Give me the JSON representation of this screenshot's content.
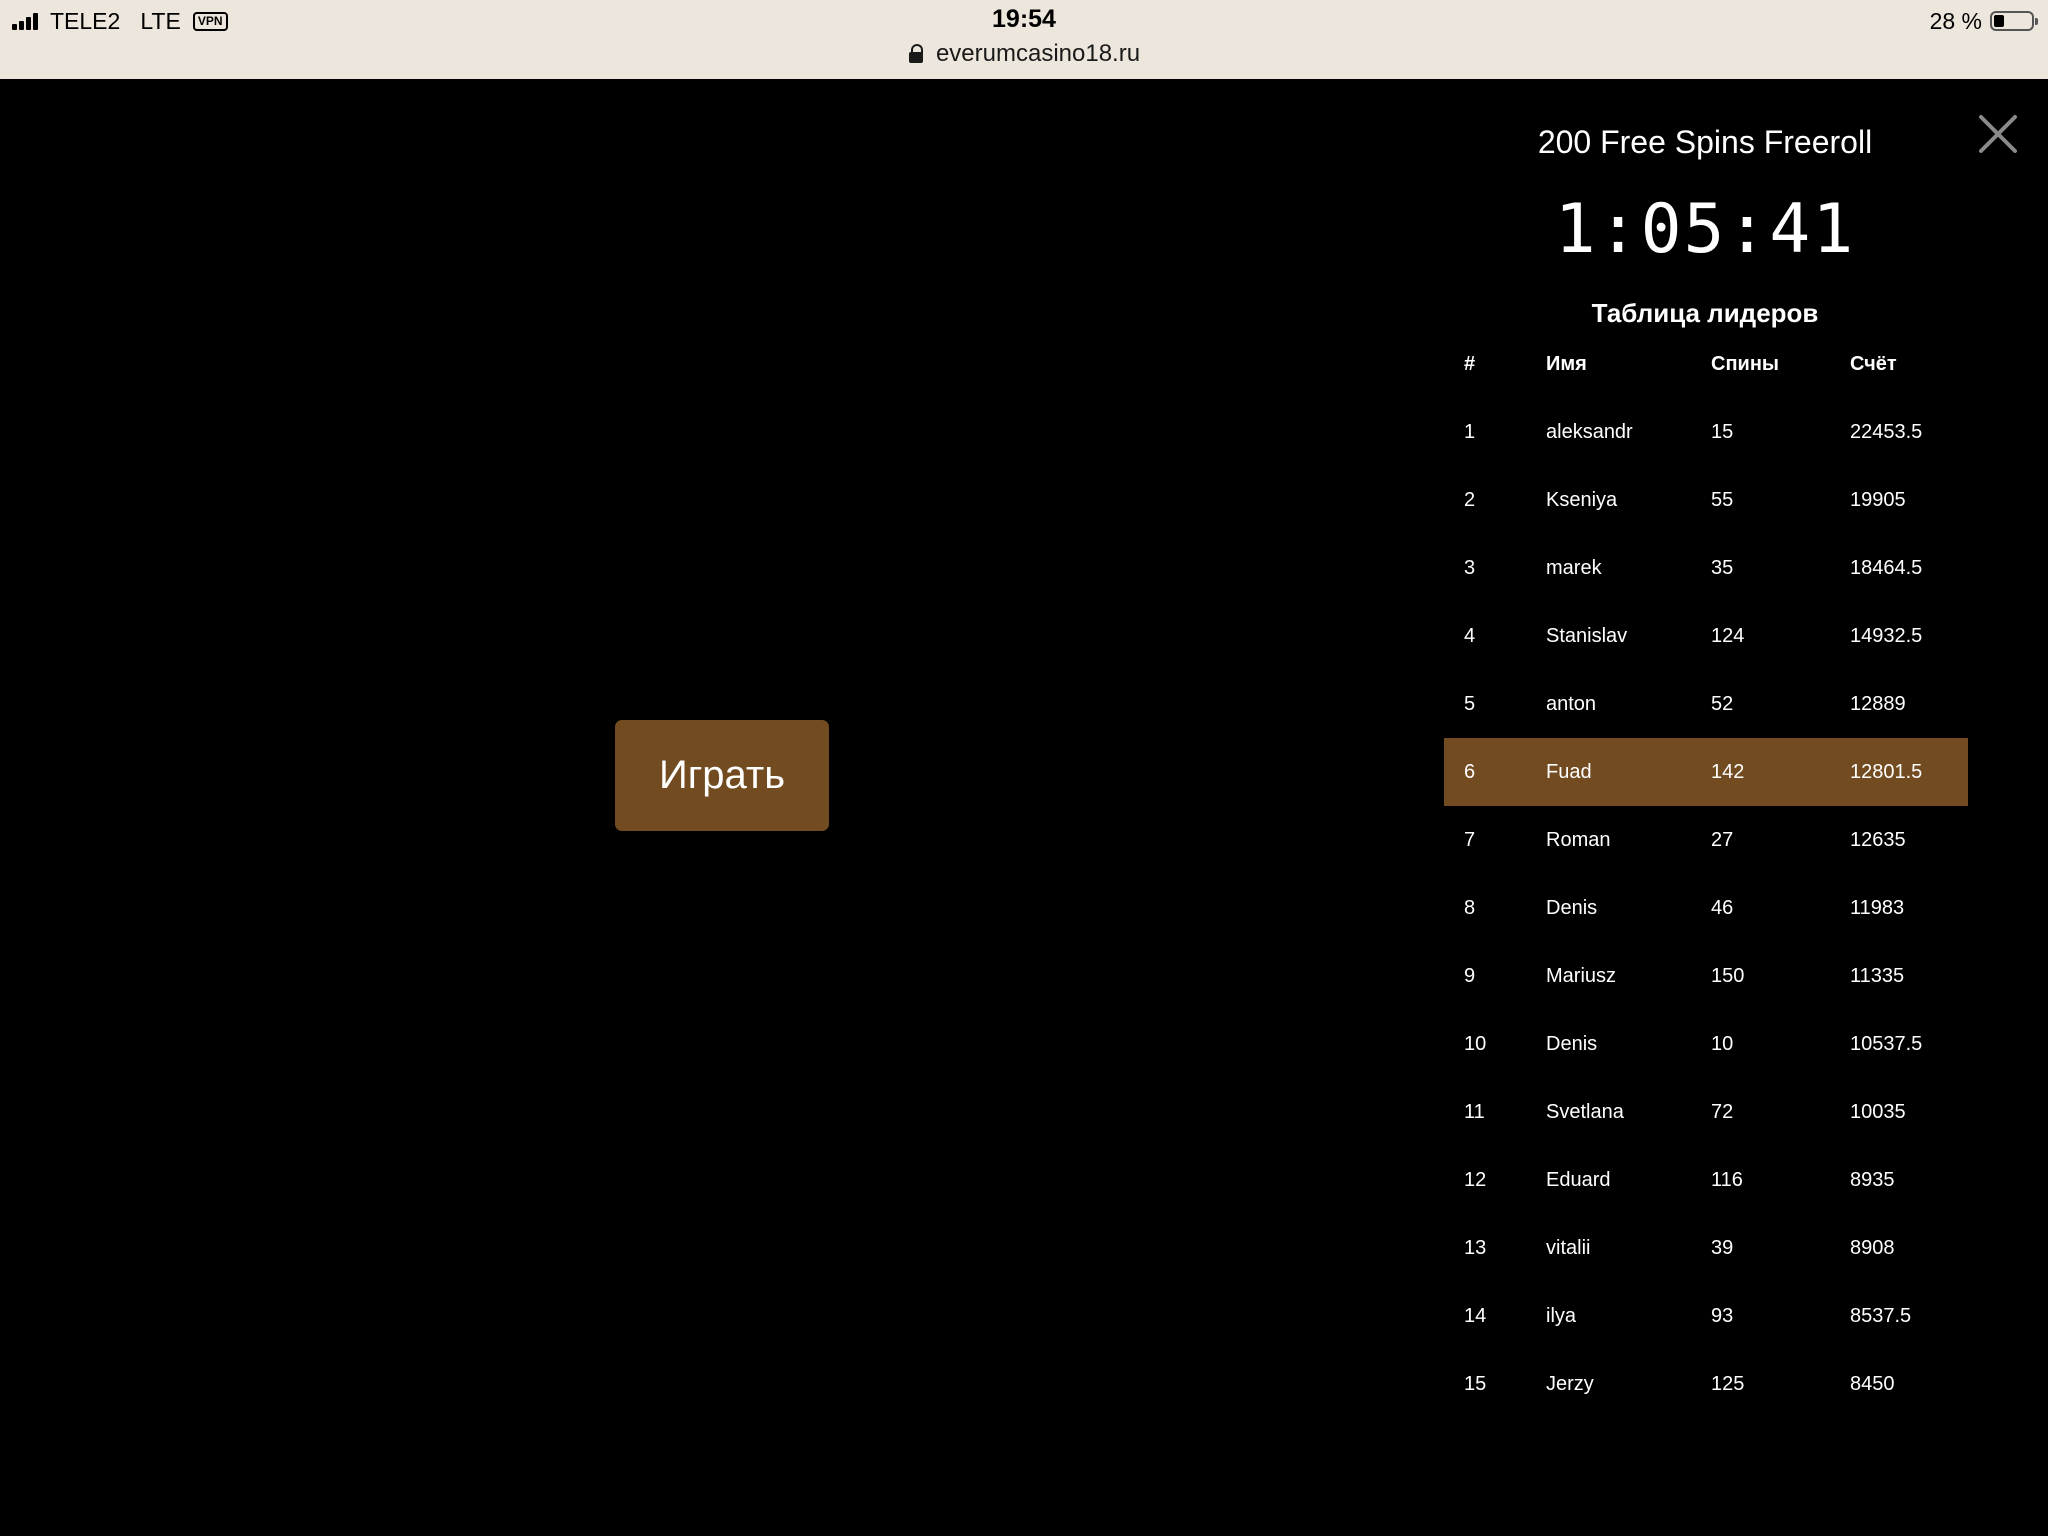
{
  "status_bar": {
    "carrier": "TELE2",
    "network": "LTE",
    "vpn": "VPN",
    "time": "19:54",
    "battery_text": "28 %",
    "battery_level": 0.28
  },
  "browser": {
    "url": "everumcasino18.ru"
  },
  "main": {
    "play_label": "Играть"
  },
  "tournament": {
    "title": "200 Free Spins Freeroll",
    "timer": "1:05:41",
    "leaderboard_title": "Таблица лидеров",
    "columns": [
      "#",
      "Имя",
      "Спины",
      "Счёт"
    ],
    "rows": [
      {
        "rank": "1",
        "name": "aleksandr",
        "spins": "15",
        "score": "22453.5"
      },
      {
        "rank": "2",
        "name": "Kseniya",
        "spins": "55",
        "score": "19905"
      },
      {
        "rank": "3",
        "name": "marek",
        "spins": "35",
        "score": "18464.5"
      },
      {
        "rank": "4",
        "name": "Stanislav",
        "spins": "124",
        "score": "14932.5"
      },
      {
        "rank": "5",
        "name": "anton",
        "spins": "52",
        "score": "12889"
      },
      {
        "rank": "6",
        "name": "Fuad",
        "spins": "142",
        "score": "12801.5",
        "highlight": true
      },
      {
        "rank": "7",
        "name": "Roman",
        "spins": "27",
        "score": "12635"
      },
      {
        "rank": "8",
        "name": "Denis",
        "spins": "46",
        "score": "11983"
      },
      {
        "rank": "9",
        "name": "Mariusz",
        "spins": "150",
        "score": "11335"
      },
      {
        "rank": "10",
        "name": "Denis",
        "spins": "10",
        "score": "10537.5"
      },
      {
        "rank": "11",
        "name": "Svetlana",
        "spins": "72",
        "score": "10035"
      },
      {
        "rank": "12",
        "name": "Eduard",
        "spins": "116",
        "score": "8935"
      },
      {
        "rank": "13",
        "name": "vitalii",
        "spins": "39",
        "score": "8908"
      },
      {
        "rank": "14",
        "name": "ilya",
        "spins": "93",
        "score": "8537.5"
      },
      {
        "rank": "15",
        "name": "Jerzy",
        "spins": "125",
        "score": "8450"
      }
    ]
  },
  "colors": {
    "accent": "#734b20",
    "background": "#000000",
    "topbar": "#ede6dc"
  },
  "icons": {
    "close": "close-icon",
    "lock": "lock-icon",
    "signal": "signal-icon",
    "battery": "battery-icon"
  }
}
